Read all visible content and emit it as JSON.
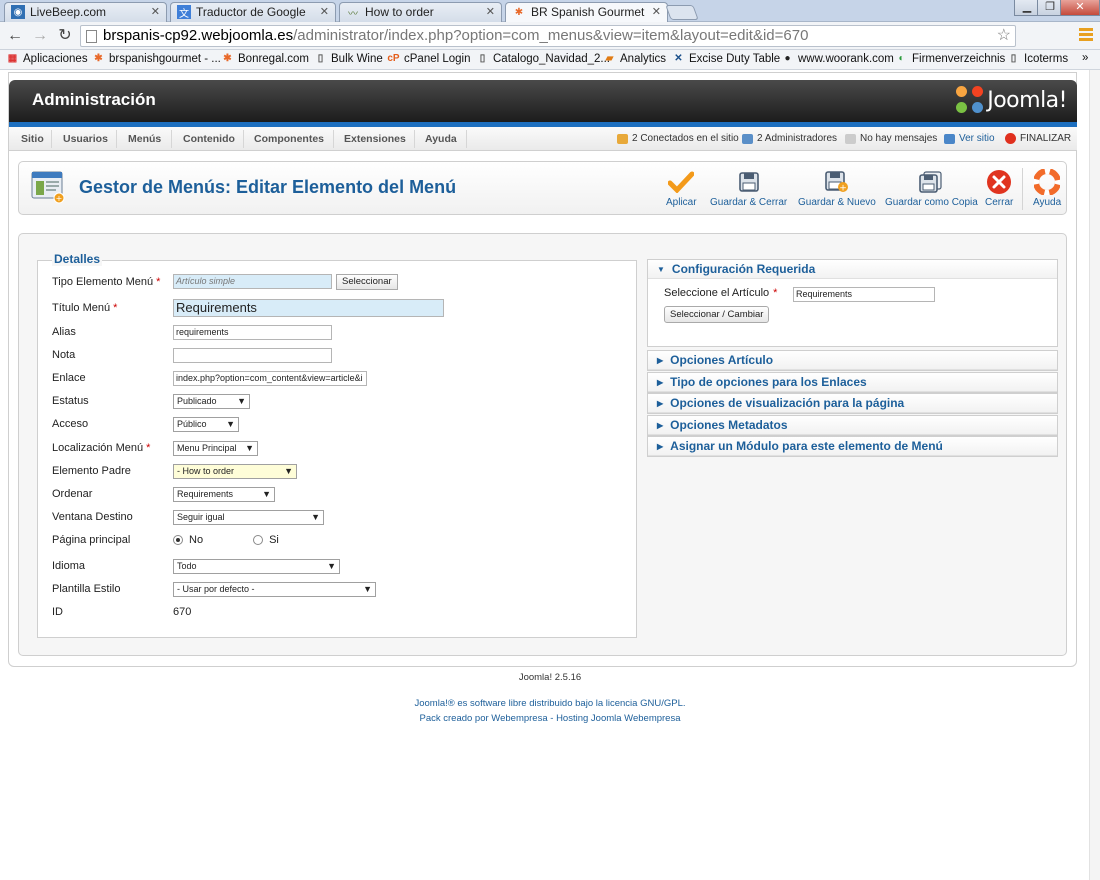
{
  "browser": {
    "tabs": [
      {
        "title": "LiveBeep.com",
        "icon": "rss-icon",
        "color": "#2f6fb3"
      },
      {
        "title": "Traductor de Google",
        "icon": "google-translate-icon",
        "color": "#3f7fd8"
      },
      {
        "title": "How to order",
        "icon": "wave-icon",
        "color": "#5a7a3a"
      },
      {
        "title": "BR Spanish Gourmet - Adı",
        "icon": "joomla-icon",
        "color": "#e8692a"
      }
    ],
    "url_host": "brspanis-cp92.webjoomla.es",
    "url_path": "/administrator/index.php?option=com_menus&view=item&layout=edit&id=670",
    "bookmarks": [
      {
        "label": "Aplicaciones",
        "icon": "apps-grid-icon",
        "color": "#d33"
      },
      {
        "label": "brspanishgourmet - ...",
        "icon": "joomla-icon",
        "color": "#e8692a"
      },
      {
        "label": "Bonregal.com",
        "icon": "joomla-icon",
        "color": "#e8692a"
      },
      {
        "label": "Bulk Wine",
        "icon": "page-icon",
        "color": "#555"
      },
      {
        "label": "cPanel Login",
        "icon": "cpanel-icon",
        "color": "#e45d1a"
      },
      {
        "label": "Catalogo_Navidad_2...",
        "icon": "page-icon",
        "color": "#555"
      },
      {
        "label": "Analytics",
        "icon": "analytics-icon",
        "color": "#e07b15"
      },
      {
        "label": "Excise Duty Table",
        "icon": "x-icon",
        "color": "#1a4f8a"
      },
      {
        "label": "www.woorank.com",
        "icon": "woorank-icon",
        "color": "#222"
      },
      {
        "label": "Firmenverzeichnis",
        "icon": "firmen-icon",
        "color": "#2a9a3a"
      },
      {
        "label": "Icoterms",
        "icon": "page-icon",
        "color": "#555"
      }
    ],
    "more": "»"
  },
  "header": {
    "title": "Administración",
    "logo_text": "Joomla!"
  },
  "menu": {
    "items": [
      "Sitio",
      "Usuarios",
      "Menús",
      "Contenido",
      "Componentes",
      "Extensiones",
      "Ayuda"
    ],
    "status": {
      "online": "2 Conectados en el sitio",
      "admins": "2 Administradores",
      "messages": "No hay mensajes",
      "view_site": "Ver sitio",
      "logout": "FINALIZAR"
    }
  },
  "toolbar": {
    "title": "Gestor de Menús: Editar Elemento del Menú",
    "buttons": {
      "apply": "Aplicar",
      "save_close": "Guardar & Cerrar",
      "save_new": "Guardar & Nuevo",
      "save_copy": "Guardar como Copia",
      "close": "Cerrar",
      "help": "Ayuda"
    }
  },
  "details": {
    "legend": "Detalles",
    "type_label": "Tipo Elemento Menú",
    "type_value": "Artículo simple",
    "select_button": "Seleccionar",
    "title_label": "Título Menú",
    "title_value": "Requirements",
    "alias_label": "Alias",
    "alias_value": "requirements",
    "note_label": "Nota",
    "note_value": "",
    "link_label": "Enlace",
    "link_value": "index.php?option=com_content&view=article&i",
    "status_label": "Estatus",
    "status_value": "Publicado",
    "access_label": "Acceso",
    "access_value": "Público",
    "location_label": "Localización Menú",
    "location_value": "Menu Principal",
    "parent_label": "Elemento Padre",
    "parent_value": "- How to order",
    "order_label": "Ordenar",
    "order_value": "Requirements",
    "target_label": "Ventana Destino",
    "target_value": "Seguir igual",
    "home_label": "Página principal",
    "home_no": "No",
    "home_yes": "Si",
    "home_selected": "No",
    "lang_label": "Idioma",
    "lang_value": "Todo",
    "style_label": "Plantilla Estilo",
    "style_value": "- Usar por defecto -",
    "id_label": "ID",
    "id_value": "670"
  },
  "panels": {
    "required": {
      "title": "Configuración Requerida",
      "article_label": "Seleccione el Artículo",
      "article_value": "Requirements",
      "change_button": "Seleccionar / Cambiar"
    },
    "collapsed": [
      "Opciones Artículo",
      "Tipo de opciones para los Enlaces",
      "Opciones de visualización para la página",
      "Opciones Metadatos",
      "Asignar un Módulo para este elemento de Menú"
    ]
  },
  "footer": {
    "version": "Joomla! 2.5.16",
    "license": "Joomla!® es software libre distribuido bajo la licencia GNU/GPL.",
    "pack": "Pack creado por Webempresa - Hosting Joomla Webempresa"
  },
  "colors": {
    "link_blue": "#1d5f9a",
    "header_dark": "#1c1c1c",
    "accent_blue": "#1d6fbf",
    "required_red": "#cc0000"
  }
}
